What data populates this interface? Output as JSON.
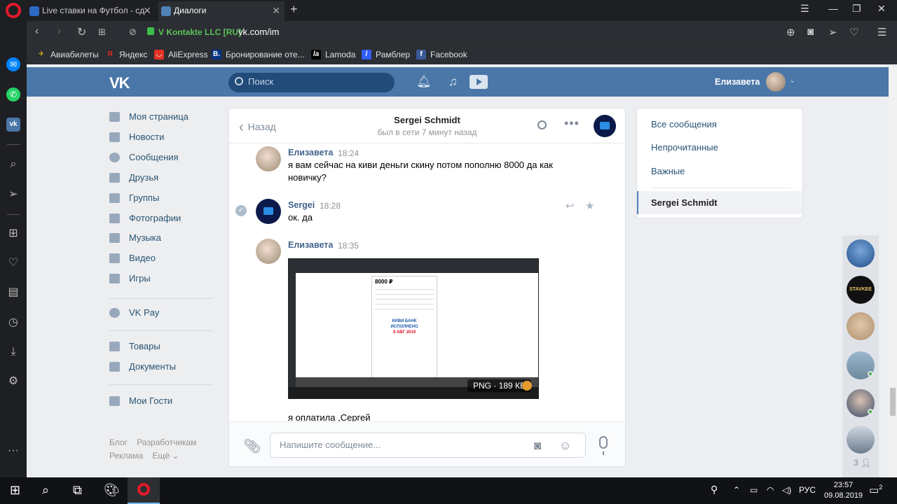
{
  "browser": {
    "tabs": [
      {
        "title": "Live ставки на Футбол - сд"
      },
      {
        "title": "Диалоги"
      }
    ],
    "site_identity": "V Kontakte LLC [RU]",
    "url": "vk.com/im",
    "bookmarks": [
      {
        "label": "Авиабилеты",
        "color": "#f4b400"
      },
      {
        "label": "Яндекс",
        "color": "#e52620"
      },
      {
        "label": "AliExpress",
        "color": "#e43225"
      },
      {
        "label": "Бронирование оте...",
        "color": "#003580"
      },
      {
        "label": "Lamoda",
        "color": "#000000"
      },
      {
        "label": "Рамблер",
        "color": "#315efb"
      },
      {
        "label": "Facebook",
        "color": "#3b5998"
      }
    ]
  },
  "vk": {
    "search_placeholder": "Поиск",
    "user_name": "Елизавета",
    "nav": [
      {
        "label": "Моя страница"
      },
      {
        "label": "Новости"
      },
      {
        "label": "Сообщения"
      },
      {
        "label": "Друзья"
      },
      {
        "label": "Группы"
      },
      {
        "label": "Фотографии"
      },
      {
        "label": "Музыка"
      },
      {
        "label": "Видео"
      },
      {
        "label": "Игры"
      },
      {
        "label": "VK Pay"
      },
      {
        "label": "Товары"
      },
      {
        "label": "Документы"
      },
      {
        "label": "Мои Гости"
      }
    ],
    "footer": {
      "blog": "Блог",
      "dev": "Разработчикам",
      "ads": "Реклама",
      "more": "Ещё"
    }
  },
  "dialog": {
    "back_label": "Назад",
    "peer_name": "Sergei Schmidt",
    "peer_status": "был в сети 7 минут назад",
    "messages": [
      {
        "author": "Елизавета",
        "time": "18:24",
        "text": "я вам сейчас на киви деньги скину потом пополню 8000 да как новичку?"
      },
      {
        "author": "Sergei",
        "time": "18:28",
        "text": "ок. да"
      },
      {
        "author": "Елизавета",
        "time": "18:35",
        "text": "я оплатила ,Сергей",
        "attachment": {
          "badge": "PNG · 189 КБ",
          "amount": "8000 ₽",
          "bank_stamp": "КИВИ БАНК",
          "stamp_status": "ИСПОЛНЕНО",
          "stamp_date": "9 АВГ 2019"
        }
      }
    ],
    "composer_placeholder": "Напишите сообщение..."
  },
  "folders": {
    "items": [
      {
        "label": "Все сообщения"
      },
      {
        "label": "Непрочитанные"
      },
      {
        "label": "Важные"
      }
    ],
    "active": "Sergei Schmidt"
  },
  "fastchat": {
    "count": "3",
    "badge_text": "STAVKEE"
  },
  "taskbar": {
    "lang": "РУС",
    "time": "23:57",
    "date": "09.08.2019",
    "notif_count": "2"
  }
}
